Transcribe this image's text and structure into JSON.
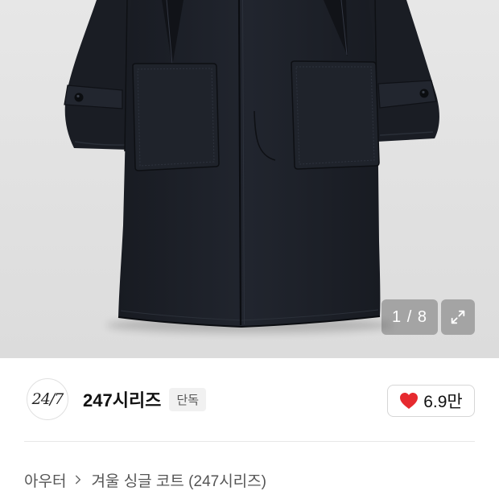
{
  "gallery": {
    "counter": "1 / 8",
    "expand_icon": "expand-icon"
  },
  "brand": {
    "logo_text": "24/7",
    "name": "247시리즈",
    "badge": "단독"
  },
  "like": {
    "icon": "heart-icon",
    "count": "6.9만"
  },
  "breadcrumb": {
    "items": [
      "아우터",
      "겨울 싱글 코트 (247시리즈)"
    ],
    "separator_icon": "chevron-right-icon"
  },
  "colors": {
    "like_heart": "#e62a2f",
    "text_primary": "#111111",
    "text_secondary": "#555555",
    "coat": "#1c2029",
    "image_background": "#e4e4e4"
  }
}
